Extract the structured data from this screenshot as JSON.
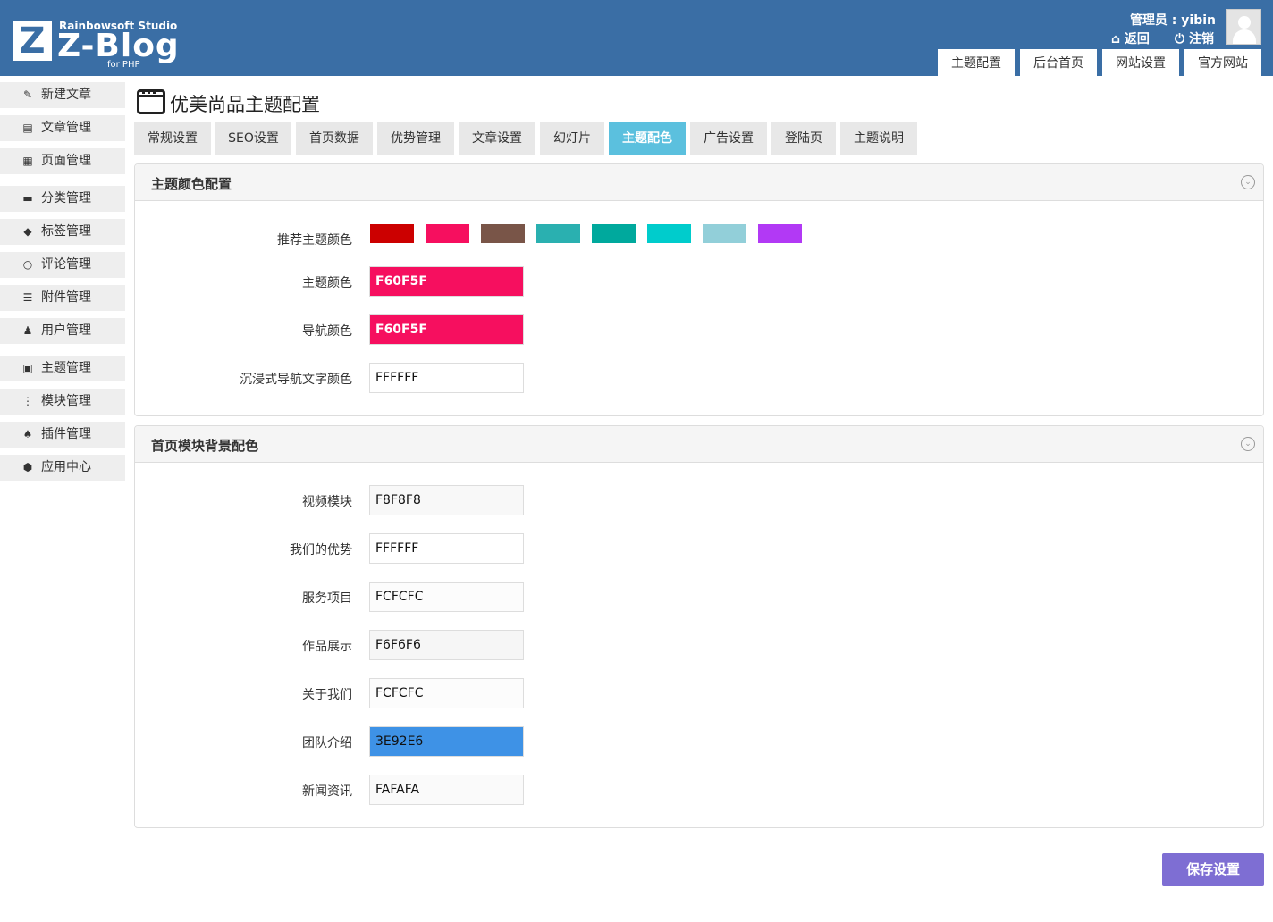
{
  "header": {
    "logo_studio": "Rainbowsoft Studio",
    "logo_main": "Z-Blog",
    "logo_sub": "for PHP",
    "logo_letter": "Z",
    "admin": "管理员 : yibin",
    "back": "返回",
    "logout": "注销",
    "tabs": [
      "主题配置",
      "后台首页",
      "网站设置",
      "官方网站"
    ]
  },
  "sidebar": {
    "items": [
      {
        "label": "新建文章",
        "icon": "edit-icon"
      },
      {
        "label": "文章管理",
        "icon": "article-icon"
      },
      {
        "label": "页面管理",
        "icon": "page-icon"
      },
      {
        "label": "分类管理",
        "icon": "folder-icon"
      },
      {
        "label": "标签管理",
        "icon": "tag-icon"
      },
      {
        "label": "评论管理",
        "icon": "comment-icon"
      },
      {
        "label": "附件管理",
        "icon": "attachment-icon"
      },
      {
        "label": "用户管理",
        "icon": "user-icon"
      },
      {
        "label": "主题管理",
        "icon": "theme-icon"
      },
      {
        "label": "模块管理",
        "icon": "module-icon"
      },
      {
        "label": "插件管理",
        "icon": "plugin-icon"
      },
      {
        "label": "应用中心",
        "icon": "app-center-icon"
      }
    ]
  },
  "main": {
    "title": "优美尚品主题配置",
    "tabs": [
      "常规设置",
      "SEO设置",
      "首页数据",
      "优势管理",
      "文章设置",
      "幻灯片",
      "主题配色",
      "广告设置",
      "登陆页",
      "主题说明"
    ],
    "active_tab": "主题配色",
    "panel1": {
      "title": "主题颜色配置",
      "recommend_label": "推荐主题颜色",
      "swatches": [
        "#cc0000",
        "#f60f5f",
        "#795548",
        "#2ab0b0",
        "#00a99d",
        "#00cccc",
        "#92cfd9",
        "#b239f5"
      ],
      "fields": [
        {
          "label": "主题颜色",
          "value": "F60F5F",
          "bg": "#f60f5f",
          "fg": "#ffffff"
        },
        {
          "label": "导航颜色",
          "value": "F60F5F",
          "bg": "#f60f5f",
          "fg": "#ffffff"
        },
        {
          "label": "沉浸式导航文字颜色",
          "value": "FFFFFF",
          "bg": "#ffffff",
          "fg": "#111111"
        }
      ]
    },
    "panel2": {
      "title": "首页模块背景配色",
      "fields": [
        {
          "label": "视频模块",
          "value": "F8F8F8",
          "bg": "#f8f8f8",
          "fg": "#111111"
        },
        {
          "label": "我们的优势",
          "value": "FFFFFF",
          "bg": "#ffffff",
          "fg": "#111111"
        },
        {
          "label": "服务项目",
          "value": "FCFCFC",
          "bg": "#fcfcfc",
          "fg": "#111111"
        },
        {
          "label": "作品展示",
          "value": "F6F6F6",
          "bg": "#f6f6f6",
          "fg": "#111111"
        },
        {
          "label": "关于我们",
          "value": "FCFCFC",
          "bg": "#fcfcfc",
          "fg": "#111111"
        },
        {
          "label": "团队介绍",
          "value": "3E92E6",
          "bg": "#3e92e6",
          "fg": "#111111"
        },
        {
          "label": "新闻资讯",
          "value": "FAFAFA",
          "bg": "#fafafa",
          "fg": "#111111"
        }
      ]
    },
    "save_label": "保存设置"
  }
}
